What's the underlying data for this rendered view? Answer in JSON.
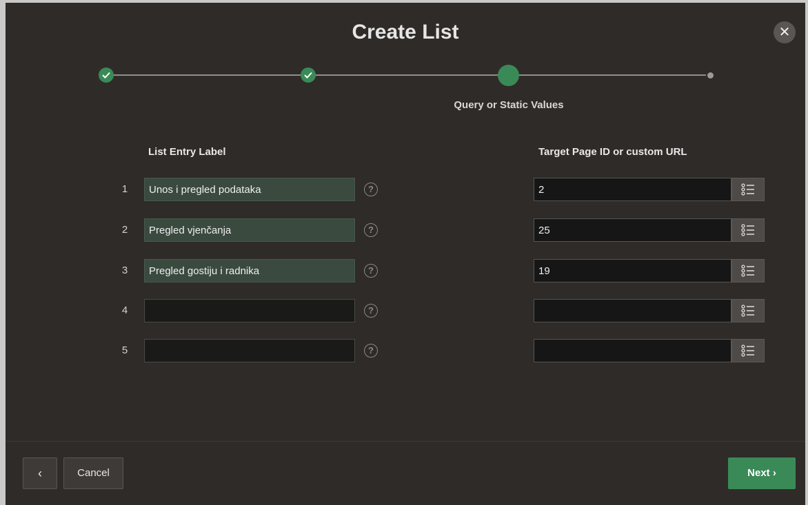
{
  "dialog": {
    "title": "Create List",
    "close_icon": "close-icon"
  },
  "wizard": {
    "current_step_label": "Query or Static Values",
    "steps": [
      {
        "state": "complete"
      },
      {
        "state": "complete"
      },
      {
        "state": "current"
      },
      {
        "state": "pending"
      }
    ]
  },
  "columns": {
    "label_header": "List Entry Label",
    "url_header": "Target Page ID or custom URL"
  },
  "rows": [
    {
      "num": "1",
      "label": "Unos i pregled podataka",
      "target": "2"
    },
    {
      "num": "2",
      "label": "Pregled vjenčanja",
      "target": "25"
    },
    {
      "num": "3",
      "label": "Pregled gostiju i radnika",
      "target": "19"
    },
    {
      "num": "4",
      "label": "",
      "target": ""
    },
    {
      "num": "5",
      "label": "",
      "target": ""
    }
  ],
  "footer": {
    "back_label": "‹",
    "cancel_label": "Cancel",
    "next_label": "Next ›"
  },
  "colors": {
    "accent": "#3a8a57",
    "background": "#2f2b28"
  }
}
